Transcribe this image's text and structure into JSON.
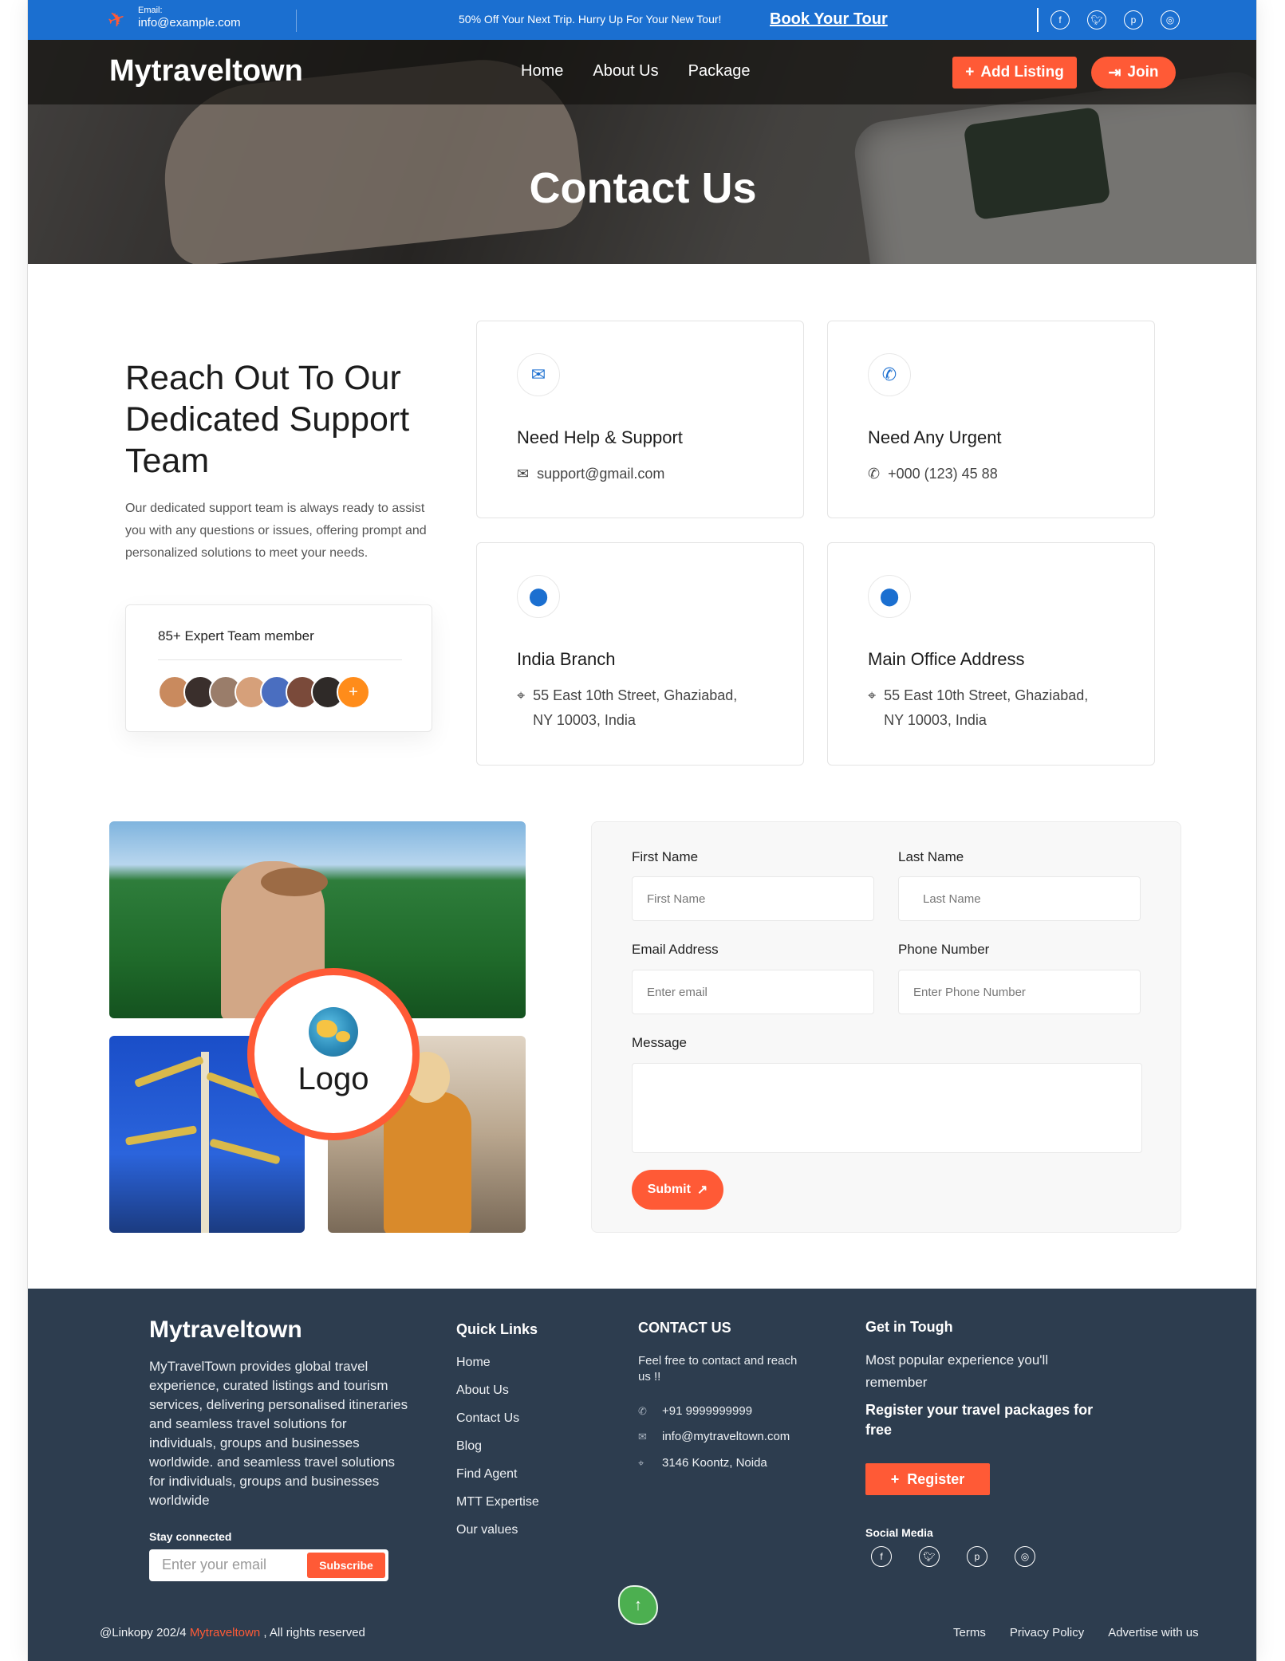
{
  "topbar": {
    "email_label": "Email:",
    "email_value": "info@example.com",
    "promo": "50% Off Your Next Trip. Hurry Up For Your New Tour!",
    "book_link": "Book Your Tour",
    "social_icons": [
      "f",
      "t",
      "p",
      "ig"
    ]
  },
  "header": {
    "brand": "Mytraveltown",
    "nav": [
      "Home",
      "About Us",
      "Package"
    ],
    "add_listing": "Add Listing",
    "join": "Join"
  },
  "hero": {
    "title": "Contact Us"
  },
  "intro": {
    "title": "Reach Out To Our Dedicated Support Team",
    "text": "Our dedicated support team is always ready to assist you with any questions or issues, offering prompt and personalized solutions to meet your needs.",
    "team_label": "85+ Expert Team member",
    "avatar_colors": [
      "#c98a5e",
      "#3a2f2c",
      "#9a7d6a",
      "#d6a07a",
      "#4a6ec0",
      "#7a4a3a",
      "#2f2a28"
    ],
    "plus_icon": "+"
  },
  "contacts": [
    {
      "icon": "envelope-icon",
      "title": "Need Help & Support",
      "value": "support@gmail.com",
      "line2": ""
    },
    {
      "icon": "phone-icon",
      "title": "Need Any Urgent",
      "value": "+000 (123) 45 88",
      "line2": ""
    },
    {
      "icon": "location-icon",
      "title": "India Branch",
      "value": "55 East 10th Street, Ghaziabad,",
      "line2": "NY 10003, India"
    },
    {
      "icon": "location-icon",
      "title": "Main Office Address",
      "value": "55 East 10th Street, Ghaziabad,",
      "line2": "NY 10003, India"
    }
  ],
  "collage": {
    "logo_text": "Logo"
  },
  "form": {
    "first_name_label": "First Name",
    "first_name_placeholder": "First Name",
    "last_name_label": "Last Name",
    "last_name_placeholder": "Last Name",
    "email_label": "Email Address",
    "email_placeholder": "Enter email",
    "phone_label": "Phone Number",
    "phone_placeholder": "Enter Phone Number",
    "message_label": "Message",
    "submit": "Submit"
  },
  "footer": {
    "brand": "Mytraveltown",
    "description": "MyTravelTown provides global travel experience, curated listings and tourism services, delivering personalised itineraries and seamless travel solutions for individuals, groups and businesses worldwide.  and seamless travel solutions for individuals, groups and businesses worldwide",
    "stay_connected": "Stay connected",
    "email_placeholder": "Enter your email",
    "subscribe": "Subscribe",
    "quick_links_title": "Quick Links",
    "quick_links": [
      "Home",
      "About Us",
      "Contact Us",
      "Blog",
      "Find Agent",
      "MTT Expertise",
      "Our values"
    ],
    "contact_title": "CONTACT US",
    "contact_text": "Feel free to contact and reach us !!",
    "phone": "+91 9999999999",
    "email": "info@mytraveltown.com",
    "address": "3146 Koontz, Noida",
    "get_title": "Get in Tough",
    "get_sub": "Most popular experience you'll remember",
    "get_bold": "Register your travel packages for free",
    "register": "Register",
    "social_title": "Social Media",
    "copyright_prefix": "@Linkopy 202/4",
    "copyright_brand": "Mytraveltown",
    "copyright_suffix": ", All rights reserved",
    "bottom_links": [
      "Terms",
      "Privacy Policy",
      "Advertise with us"
    ]
  }
}
